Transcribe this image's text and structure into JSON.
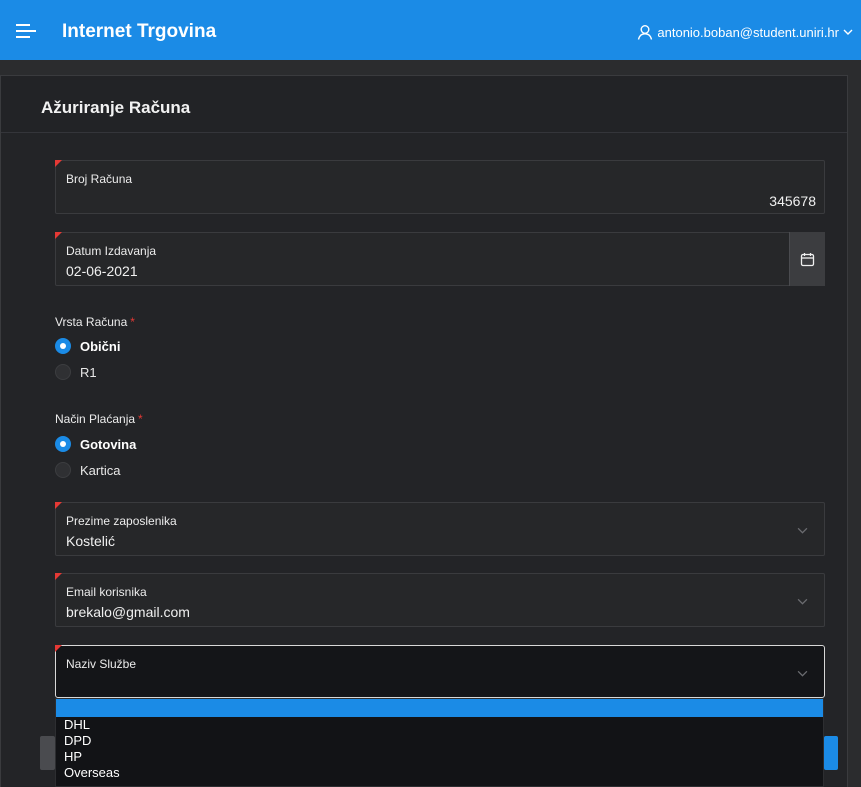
{
  "app": {
    "title": "Internet Trgovina",
    "user_email": "antonio.boban@student.uniri.hr"
  },
  "page": {
    "title": "Ažuriranje Računa"
  },
  "form": {
    "broj_racuna": {
      "label": "Broj Računa",
      "value": "345678"
    },
    "datum_izdavanja": {
      "label": "Datum Izdavanja",
      "value": "02-06-2021"
    },
    "vrsta_racuna": {
      "label": "Vrsta Računa",
      "required_mark": "*",
      "options": [
        {
          "label": "Obični",
          "selected": true
        },
        {
          "label": "R1",
          "selected": false
        }
      ]
    },
    "nacin_placanja": {
      "label": "Način Plaćanja",
      "required_mark": "*",
      "options": [
        {
          "label": "Gotovina",
          "selected": true
        },
        {
          "label": "Kartica",
          "selected": false
        }
      ]
    },
    "prezime_zaposlenika": {
      "label": "Prezime zaposlenika",
      "value": "Kostelić"
    },
    "email_korisnika": {
      "label": "Email korisnika",
      "value": "brekalo@gmail.com"
    },
    "naziv_sluzbe": {
      "label": "Naziv Službe",
      "value": "",
      "options": [
        "",
        "DHL",
        "DPD",
        "HP",
        "Overseas"
      ]
    }
  },
  "colors": {
    "accent": "#1b8be6",
    "required": "#e53935",
    "background": "#2b2c2e"
  },
  "icons": {
    "menu": "hamburger-menu-icon",
    "user": "user-icon",
    "calendar": "calendar-icon",
    "chevron": "chevron-down-icon"
  }
}
